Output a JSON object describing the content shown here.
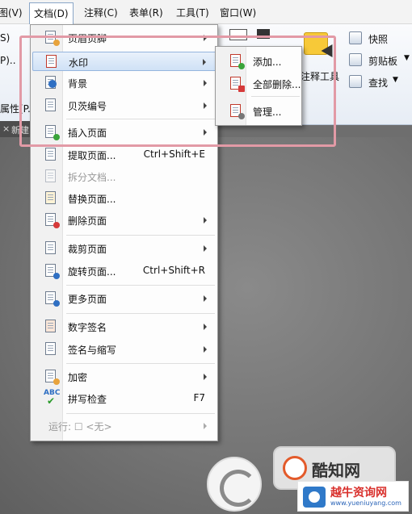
{
  "menubar": {
    "items": [
      "图(V)",
      "文档(D)",
      "注释(C)",
      "表单(R)",
      "工具(T)",
      "窗口(W)"
    ]
  },
  "ribbon": {
    "left_fragments": [
      "S)",
      "P)..",
      "属性(P..."
    ],
    "right": [
      "快照",
      "剪贴板",
      "查找"
    ],
    "annotation_tool": "注释工具",
    "tab_label": "新建"
  },
  "menu": {
    "items": [
      {
        "label": "页眉页脚",
        "shortcut": "",
        "submenu": true,
        "disabled": false,
        "icon": "header-footer-icon"
      },
      {
        "label": "水印",
        "shortcut": "",
        "submenu": true,
        "disabled": false,
        "icon": "watermark-icon"
      },
      {
        "label": "背景",
        "shortcut": "",
        "submenu": true,
        "disabled": false,
        "icon": "background-icon"
      },
      {
        "label": "贝茨编号",
        "shortcut": "",
        "submenu": true,
        "disabled": false,
        "icon": "bates-number-icon"
      },
      {
        "label": "插入页面",
        "shortcut": "",
        "submenu": true,
        "disabled": false,
        "icon": "insert-page-icon"
      },
      {
        "label": "提取页面...",
        "shortcut": "Ctrl+Shift+E",
        "submenu": false,
        "disabled": false,
        "icon": "extract-page-icon"
      },
      {
        "label": "拆分文档...",
        "shortcut": "",
        "submenu": false,
        "disabled": true,
        "icon": "split-document-icon"
      },
      {
        "label": "替换页面...",
        "shortcut": "",
        "submenu": false,
        "disabled": false,
        "icon": "replace-page-icon"
      },
      {
        "label": "删除页面",
        "shortcut": "",
        "submenu": true,
        "disabled": false,
        "icon": "delete-page-icon"
      },
      {
        "label": "裁剪页面",
        "shortcut": "",
        "submenu": true,
        "disabled": false,
        "icon": "crop-page-icon"
      },
      {
        "label": "旋转页面...",
        "shortcut": "Ctrl+Shift+R",
        "submenu": false,
        "disabled": false,
        "icon": "rotate-page-icon"
      },
      {
        "label": "更多页面",
        "shortcut": "",
        "submenu": true,
        "disabled": false,
        "icon": "more-pages-icon"
      },
      {
        "label": "数字签名",
        "shortcut": "",
        "submenu": true,
        "disabled": false,
        "icon": "digital-signature-icon"
      },
      {
        "label": "签名与缩写",
        "shortcut": "",
        "submenu": true,
        "disabled": false,
        "icon": "sign-initials-icon"
      },
      {
        "label": "加密",
        "shortcut": "",
        "submenu": true,
        "disabled": false,
        "icon": "encrypt-icon"
      },
      {
        "label": "拼写检查",
        "shortcut": "F7",
        "submenu": false,
        "disabled": false,
        "icon": "spell-check-icon"
      },
      {
        "label": "运行: ☐ <无>",
        "shortcut": "",
        "submenu": true,
        "disabled": true,
        "icon": ""
      }
    ]
  },
  "submenu": {
    "items": [
      "添加...",
      "全部删除...",
      "管理..."
    ]
  },
  "watermark": {
    "site_name": "酷知网",
    "brand_name": "越牛资询网",
    "brand_url": "www.yueniuyang.com"
  }
}
